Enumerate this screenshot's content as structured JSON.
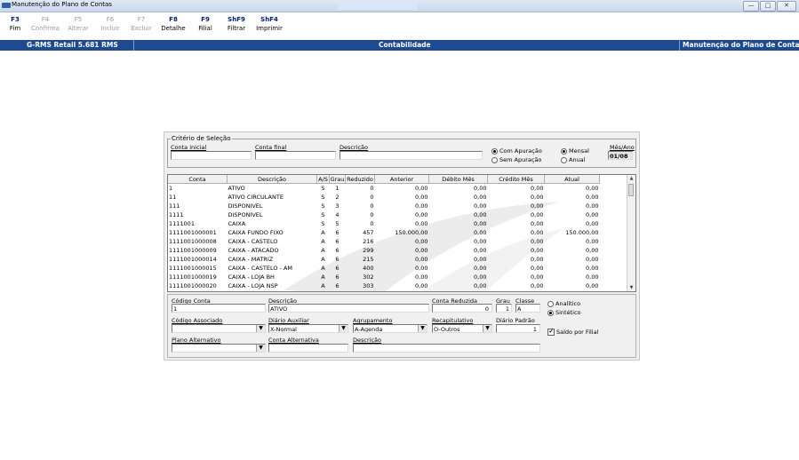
{
  "window": {
    "title": "Manutenção do Plano de Contas",
    "buttons": [
      "—",
      "□",
      "✕"
    ]
  },
  "toolbar": {
    "keys": [
      {
        "key": "F3",
        "label": "Fim",
        "enabled": true
      },
      {
        "key": "F4",
        "label": "Confirma",
        "enabled": false
      },
      {
        "key": "F5",
        "label": "Alterar",
        "enabled": false
      },
      {
        "key": "F6",
        "label": "Incluir",
        "enabled": false
      },
      {
        "key": "F7",
        "label": "Excluir",
        "enabled": false
      },
      {
        "key": "F8",
        "label": "Detalhe",
        "enabled": true
      },
      {
        "key": "F9",
        "label": "Filial",
        "enabled": true
      },
      {
        "key": "ShF9",
        "label": "Filtrar",
        "enabled": true
      },
      {
        "key": "ShF4",
        "label": "Imprimir",
        "enabled": true
      }
    ]
  },
  "band": {
    "left": "G-RMS Retail 5.681 RMS",
    "center": "Contabilidade",
    "right": "Manutenção do Plano de Contas"
  },
  "criteria": {
    "legend": "Critério de Seleção",
    "conta_inicial_label": "Conta inicial",
    "conta_final_label": "Conta final",
    "descricao_label": "Descrição",
    "conta_inicial": "",
    "conta_final": "",
    "descricao": "",
    "apuracao_options": [
      "Com Apuração",
      "Sem Apuração"
    ],
    "apuracao_selected": "Com Apuração",
    "periodo_options": [
      "Mensal",
      "Anual"
    ],
    "periodo_selected": "Mensal",
    "mes_ano_label": "Mês/Ano",
    "mes_ano": "01/08"
  },
  "grid": {
    "columns": [
      "Conta",
      "Descrição",
      "A/S",
      "Grau",
      "Reduzido",
      "Anterior",
      "Débito Mês",
      "Crédito Mês",
      "Atual"
    ],
    "rows": [
      [
        "1",
        "ATIVO",
        "S",
        "1",
        "0",
        "0,00",
        "0,00",
        "0,00",
        "0,00"
      ],
      [
        "11",
        "ATIVO CIRCULANTE",
        "S",
        "2",
        "0",
        "0,00",
        "0,00",
        "0,00",
        "0,00"
      ],
      [
        "111",
        "DISPONIVEL",
        "S",
        "3",
        "0",
        "0,00",
        "0,00",
        "0,00",
        "0,00"
      ],
      [
        "1111",
        "DISPONIVEL",
        "S",
        "4",
        "0",
        "0,00",
        "0,00",
        "0,00",
        "0,00"
      ],
      [
        "1111001",
        "CAIXA",
        "S",
        "5",
        "0",
        "0,00",
        "0,00",
        "0,00",
        "0,00"
      ],
      [
        "1111001000001",
        "CAIXA FUNDO FIXO",
        "A",
        "6",
        "457",
        "150.000,00",
        "0,00",
        "0,00",
        "150.000,00"
      ],
      [
        "1111001000008",
        "CAIXA - CASTELO",
        "A",
        "6",
        "216",
        "0,00",
        "0,00",
        "0,00",
        "0,00"
      ],
      [
        "1111001000009",
        "CAIXA - ATACADO",
        "A",
        "6",
        "299",
        "0,00",
        "0,00",
        "0,00",
        "0,00"
      ],
      [
        "1111001000014",
        "CAIXA - MATRIZ",
        "A",
        "6",
        "215",
        "0,00",
        "0,00",
        "0,00",
        "0,00"
      ],
      [
        "1111001000015",
        "CAIXA - CASTELO - AM",
        "A",
        "6",
        "400",
        "0,00",
        "0,00",
        "0,00",
        "0,00"
      ],
      [
        "1111001000019",
        "CAIXA - LOJA BH",
        "A",
        "6",
        "302",
        "0,00",
        "0,00",
        "0,00",
        "0,00"
      ],
      [
        "1111001000020",
        "CAIXA - LOJA NSP",
        "A",
        "6",
        "303",
        "0,00",
        "0,00",
        "0,00",
        "0,00"
      ]
    ]
  },
  "detail": {
    "codigo_conta_label": "Código Conta",
    "codigo_conta": "1",
    "descricao_label": "Descrição",
    "descricao": "ATIVO",
    "conta_reduzida_label": "Conta Reduzida",
    "conta_reduzida": "0",
    "grau_label": "Grau",
    "grau": "1",
    "classe_label": "Classe",
    "classe": "A",
    "tipo_options": [
      "Analítico",
      "Sintético"
    ],
    "tipo_selected": "Sintético",
    "codigo_associado_label": "Código Associado",
    "codigo_associado": "",
    "diario_auxiliar_label": "Diário Auxiliar",
    "diario_auxiliar": "X-Normal",
    "agrupamento_label": "Agrupamento",
    "agrupamento": "A-Agenda",
    "recapitulativo_label": "Recapitulativo",
    "recapitulativo": "O-Outros",
    "diario_padrao_label": "Diário Padrão",
    "diario_padrao": "1",
    "saldo_filial_label": "Saldo por Filial",
    "saldo_filial_checked": true,
    "plano_alternativo_label": "Plano Alternativo",
    "plano_alternativo": "",
    "conta_alternativa_label": "Conta Alternativa",
    "conta_alternativa": "",
    "descricao2_label": "Descrição",
    "descricao2": ""
  }
}
